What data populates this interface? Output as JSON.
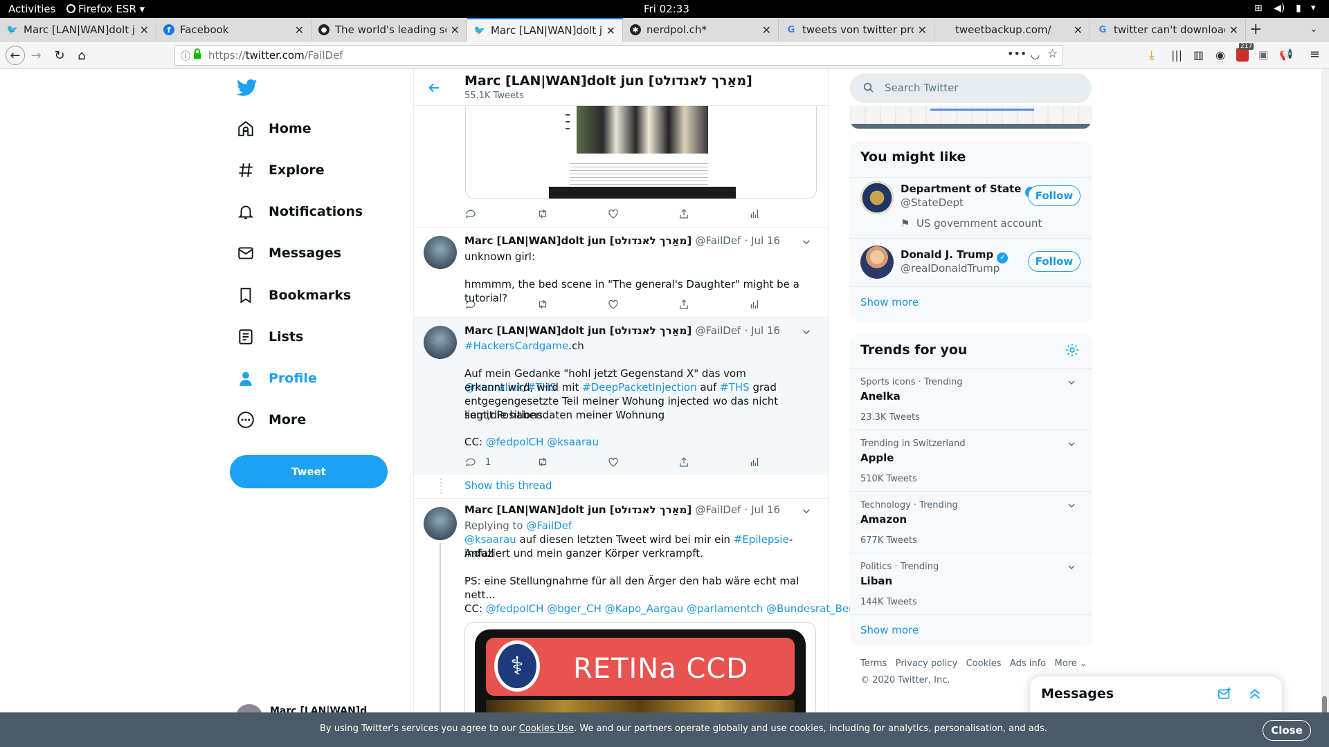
{
  "topbar": {
    "activities": "Activities",
    "app": "Firefox ESR",
    "clock": "Fri 02:33",
    "badge": "217"
  },
  "tabs": [
    {
      "label": "Marc [LAN|WAN]dolt jun"
    },
    {
      "label": "Facebook"
    },
    {
      "label": "The world's leading softw"
    },
    {
      "label": "Marc [LAN|WAN]dolt jun"
    },
    {
      "label": "nerdpol.ch*"
    },
    {
      "label": "tweets von twitter profil"
    },
    {
      "label": "tweetbackup.com/"
    },
    {
      "label": "twitter can't download m"
    }
  ],
  "url": {
    "prefix": "https://",
    "host": "twitter.com",
    "path": "/FailDef"
  },
  "sidebar": {
    "items": [
      {
        "label": "Home"
      },
      {
        "label": "Explore"
      },
      {
        "label": "Notifications"
      },
      {
        "label": "Messages"
      },
      {
        "label": "Bookmarks"
      },
      {
        "label": "Lists"
      },
      {
        "label": "Profile"
      },
      {
        "label": "More"
      }
    ],
    "tweet_button": "Tweet",
    "account_name": "Marc [LAN|WAN]d"
  },
  "header": {
    "name": "Marc [LAN|WAN]dolt jun [מאַרך לאנדולט]",
    "count": "55.1K Tweets"
  },
  "tweets": [
    {
      "name": "Marc [LAN|WAN]dolt jun [מאַרך לאנדולט]",
      "handle": "@FailDef",
      "date": "· Jul 16",
      "line1": "unknown girl:",
      "line2": "hmmmm, the bed scene in \"The general's Daughter\" might be a tutorial?"
    },
    {
      "name": "Marc [LAN|WAN]dolt jun [מאַרך לאנדולט]",
      "handle": "@FailDef",
      "date": "· Jul 16",
      "tag": "#HackersCardgame",
      "tag_suffix": ".ch",
      "p1a": "Auf mein Gedanke \"hohl jetzt Gegenstand X\" das vom ",
      "p1_link1": "@neuralink",
      "p1_sep": "/",
      "p1_link2": "#THS",
      "p2a": "erkannt wird, wird mit ",
      "p2_link1": "#DeepPacketInjection",
      "p2_mid": " auf ",
      "p2_link2": "#THS",
      "p2_b": " grad",
      "p3": "entgegengesetzte Teil meiner Wohung injected wo das nicht liegt,die haben",
      "p4": "somit Positionsdaten meiner Wohnung",
      "cc": "CC: ",
      "cc1": "@fedpolCH",
      "cc2": "@ksaarau",
      "reply_count": "1"
    },
    {
      "show_thread": "Show this thread"
    },
    {
      "name": "Marc [LAN|WAN]dolt jun [מאַרך לאנדולט]",
      "handle": "@FailDef",
      "date": "· Jul 16",
      "replying": "Replying to ",
      "replying_to": "@FailDef",
      "l1_link": "@ksaarau",
      "l1_text": " auf diesen letzten Tweet wird bei mir ein ",
      "l1_link2": "#Epilepsie",
      "l1_end": "-Anfall",
      "l2": "induziert und mein ganzer Körper verkrampft.",
      "l3": "PS: eine Stellungnahme für all den Ärger den hab wäre echt mal nett...",
      "cc": "CC: ",
      "ccs": [
        "@fedpolCH",
        "@bger_CH",
        "@Kapo_Aargau",
        "@parlamentch",
        "@Bundesrat_Bern"
      ],
      "image_text": "RETINa CCD"
    }
  ],
  "search": {
    "placeholder": "Search Twitter"
  },
  "might_like": {
    "title": "You might like",
    "accounts": [
      {
        "name": "Department of State",
        "handle": "@StateDept",
        "note": "US government account",
        "button": "Follow"
      },
      {
        "name": "Donald J. Trump",
        "handle": "@realDonaldTrump",
        "button": "Follow"
      }
    ],
    "show_more": "Show more"
  },
  "trends": {
    "title": "Trends for you",
    "items": [
      {
        "context": "Sports icons · Trending",
        "name": "Anelka",
        "count": "23.3K Tweets"
      },
      {
        "context": "Trending in Switzerland",
        "name": "Apple",
        "count": "510K Tweets"
      },
      {
        "context": "Technology · Trending",
        "name": "Amazon",
        "count": "677K Tweets"
      },
      {
        "context": "Politics · Trending",
        "name": "Liban",
        "count": "144K Tweets"
      }
    ],
    "show_more": "Show more"
  },
  "footer": {
    "terms": "Terms",
    "privacy": "Privacy policy",
    "cookies": "Cookies",
    "ads": "Ads info",
    "more": "More",
    "copyright": "© 2020 Twitter, Inc."
  },
  "messages_drawer": {
    "title": "Messages"
  },
  "cookie_banner": {
    "text_a": "By using Twitter's services you agree to our ",
    "link": "Cookies Use",
    "text_b": ". We and our partners operate globally and use cookies, including for analytics, personalisation, and ads.",
    "close": "Close"
  },
  "colors": {
    "accent": "#1da1f2",
    "link": "#1b95e0",
    "banner": "#4a5a68",
    "badge_red": "#e0245e"
  }
}
